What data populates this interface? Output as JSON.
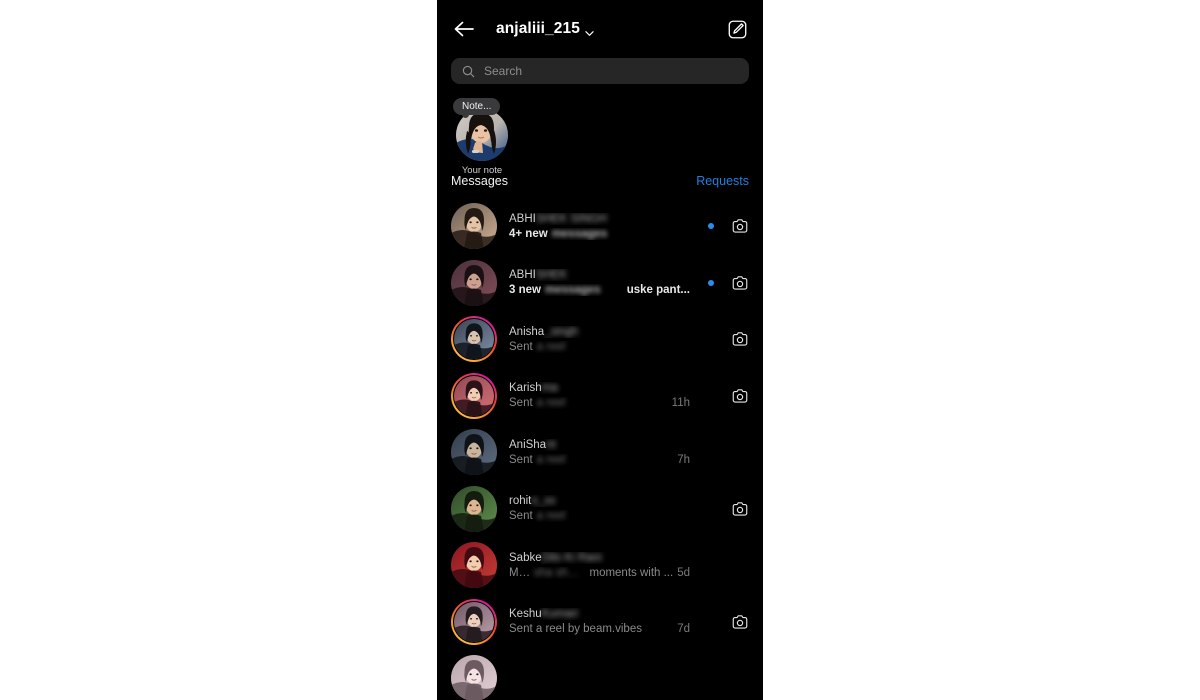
{
  "app": {
    "name": "Instagram Direct",
    "background_color": "#000000",
    "page_background": "#ffffff",
    "accent_blue": "#1f7fe0",
    "unread_dot_color": "#2a8cf0",
    "search_bg": "#262626",
    "note_bubble_bg": "#3a3a3c"
  },
  "header": {
    "back_icon": "arrow-left-icon",
    "username": "anjaliii_215",
    "chevron_icon": "chevron-down-icon",
    "compose_icon": "compose-icon"
  },
  "search": {
    "icon": "search-icon",
    "placeholder": "Search",
    "value": ""
  },
  "notes": {
    "your_note": {
      "bubble_text": "Note...",
      "label": "Your note",
      "avatar_name": "your-note-avatar"
    }
  },
  "section": {
    "title": "Messages",
    "requests_label": "Requests"
  },
  "conversations": [
    {
      "name": "ABHI",
      "name_blurred_suffix": "SHEK SINGH",
      "preview": "4+ new",
      "preview_blurred_suffix": " messages",
      "trailing_preview": "",
      "time": "",
      "unread": true,
      "has_camera": true,
      "has_story_ring": false,
      "avatar_name": "conversation-avatar-1"
    },
    {
      "name": "ABHI",
      "name_blurred_suffix": "SHEK",
      "preview": "3 new",
      "preview_blurred_suffix": " messages",
      "trailing_preview": "uske pant...",
      "time": "",
      "unread": true,
      "has_camera": true,
      "has_story_ring": false,
      "avatar_name": "conversation-avatar-2"
    },
    {
      "name": "Anisha",
      "name_blurred_suffix": "_singh",
      "preview": "Sent",
      "preview_blurred_suffix": " a reel",
      "trailing_preview": "",
      "time": "",
      "unread": false,
      "has_camera": true,
      "has_story_ring": true,
      "avatar_name": "conversation-avatar-3"
    },
    {
      "name": "Karish",
      "name_blurred_suffix": "ma",
      "preview": "Sent",
      "preview_blurred_suffix": " a reel",
      "trailing_preview": "",
      "time": "11h",
      "unread": false,
      "has_camera": true,
      "has_story_ring": true,
      "avatar_name": "conversation-avatar-4"
    },
    {
      "name": "AniSha",
      "name_blurred_suffix": "nt",
      "preview": "Sent",
      "preview_blurred_suffix": " a reel",
      "trailing_preview": "",
      "time": "7h",
      "unread": false,
      "has_camera": false,
      "has_story_ring": false,
      "avatar_name": "conversation-avatar-5"
    },
    {
      "name": "rohit",
      "name_blurred_suffix": "o_xx",
      "preview": "Sent",
      "preview_blurred_suffix": " a reel",
      "trailing_preview": "",
      "time": "",
      "unread": false,
      "has_camera": true,
      "has_story_ring": false,
      "avatar_name": "conversation-avatar-6"
    },
    {
      "name": "Sabke",
      "name_blurred_suffix": " Dilo Ki Rani",
      "preview": "Mani",
      "preview_blurred_suffix": "sha shared",
      "trailing_preview": "moments with ...",
      "time": "5d",
      "unread": false,
      "has_camera": false,
      "has_story_ring": false,
      "avatar_name": "conversation-avatar-7"
    },
    {
      "name": "Keshu",
      "name_blurred_suffix": " Kumari",
      "preview": "Sent a reel by beam.vibes",
      "preview_blurred_suffix": "",
      "trailing_preview": "",
      "time": "7d",
      "unread": false,
      "has_camera": true,
      "has_story_ring": true,
      "avatar_name": "conversation-avatar-8"
    },
    {
      "name": "",
      "name_blurred_suffix": "",
      "preview": "",
      "preview_blurred_suffix": "",
      "trailing_preview": "",
      "time": "",
      "unread": false,
      "has_camera": false,
      "has_story_ring": false,
      "avatar_name": "conversation-avatar-9"
    }
  ]
}
